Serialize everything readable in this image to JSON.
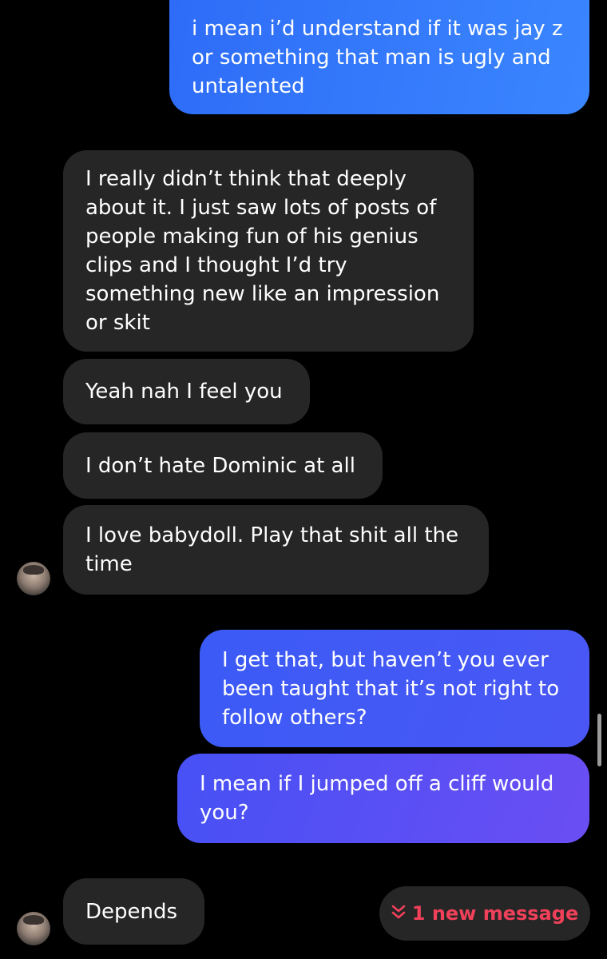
{
  "messages": {
    "out1": "i mean i’d understand if it was jay z\nor something that man is ugly and\nuntalented",
    "in1": "I really didn’t think that deeply\nabout it. I just saw lots of posts of\npeople making fun of his genius\nclips and I thought I’d try\nsomething new like an impression\nor skit",
    "in2": "Yeah nah I feel you",
    "in3": "I don’t hate Dominic at all",
    "in4": "I love babydoll. Play that shit all the\ntime",
    "out2": "I get that, but haven’t you ever\nbeen taught that it’s not right to\nfollow others?",
    "out3": "I mean if I jumped off a cliff would\nyou?",
    "in5": "Depends"
  },
  "new_message": {
    "icon": "double-chevron-down-icon",
    "glyph": "⌄",
    "label": "1 new message"
  },
  "colors": {
    "background": "#000000",
    "received_bubble": "#262626",
    "sent_bubble_start": "#2e6cf7",
    "sent_bubble_end": "#6a4ef3",
    "new_message_text": "#f0405a"
  }
}
